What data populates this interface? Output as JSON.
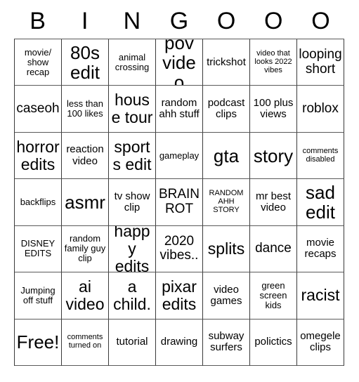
{
  "header": {
    "letters": [
      "B",
      "I",
      "N",
      "G",
      "O",
      "O",
      "O"
    ]
  },
  "grid": {
    "columns": 7,
    "rows": 7,
    "cells": [
      [
        {
          "text": "movie/ show recap",
          "size": "s-sm"
        },
        {
          "text": "80s edit",
          "size": "s-xxl"
        },
        {
          "text": "animal crossing",
          "size": "s-sm"
        },
        {
          "text": "pov video",
          "size": "s-xxl"
        },
        {
          "text": "trickshot",
          "size": "s-md"
        },
        {
          "text": "video that looks 2022 vibes",
          "size": "s-xs"
        },
        {
          "text": "looping short",
          "size": "s-lg"
        }
      ],
      [
        {
          "text": "caseoh",
          "size": "s-lg"
        },
        {
          "text": "less than 100 likes",
          "size": "s-sm"
        },
        {
          "text": "house tour",
          "size": "s-xl"
        },
        {
          "text": "random ahh stuff",
          "size": "s-md"
        },
        {
          "text": "podcast clips",
          "size": "s-md"
        },
        {
          "text": "100 plus views",
          "size": "s-md"
        },
        {
          "text": "roblox",
          "size": "s-lg"
        }
      ],
      [
        {
          "text": "horror edits",
          "size": "s-xl"
        },
        {
          "text": "reaction video",
          "size": "s-md"
        },
        {
          "text": "sports edit",
          "size": "s-xl"
        },
        {
          "text": "gameplay",
          "size": "s-sm"
        },
        {
          "text": "gta",
          "size": "s-xxl"
        },
        {
          "text": "story",
          "size": "s-xxl"
        },
        {
          "text": "comments disabled",
          "size": "s-xs"
        }
      ],
      [
        {
          "text": "backflips",
          "size": "s-sm"
        },
        {
          "text": "asmr",
          "size": "s-xxl"
        },
        {
          "text": "tv show clip",
          "size": "s-md"
        },
        {
          "text": "BRAIN ROT",
          "size": "s-lg"
        },
        {
          "text": "RANDOM AHH STORY",
          "size": "s-xs"
        },
        {
          "text": "mr best video",
          "size": "s-md"
        },
        {
          "text": "sad edit",
          "size": "s-xxl"
        }
      ],
      [
        {
          "text": "DISNEY EDITS",
          "size": "s-sm"
        },
        {
          "text": "random family guy clip",
          "size": "s-sm"
        },
        {
          "text": "happy edits",
          "size": "s-xl"
        },
        {
          "text": "2020 vibes..",
          "size": "s-lg"
        },
        {
          "text": "splits",
          "size": "s-xl"
        },
        {
          "text": "dance",
          "size": "s-lg"
        },
        {
          "text": "movie recaps",
          "size": "s-md"
        }
      ],
      [
        {
          "text": "Jumping off stuff",
          "size": "s-sm"
        },
        {
          "text": "ai video",
          "size": "s-xl"
        },
        {
          "text": "a child.",
          "size": "s-xl"
        },
        {
          "text": "pixar edits",
          "size": "s-xl"
        },
        {
          "text": "video games",
          "size": "s-md"
        },
        {
          "text": "green screen kids",
          "size": "s-sm"
        },
        {
          "text": "racist",
          "size": "s-xl"
        }
      ],
      [
        {
          "text": "Free!",
          "size": "s-xxl"
        },
        {
          "text": "comments turned on",
          "size": "s-xs"
        },
        {
          "text": "tutorial",
          "size": "s-md"
        },
        {
          "text": "drawing",
          "size": "s-md"
        },
        {
          "text": "subway surfers",
          "size": "s-md"
        },
        {
          "text": "polictics",
          "size": "s-md"
        },
        {
          "text": "omegele clips",
          "size": "s-md"
        }
      ]
    ]
  }
}
